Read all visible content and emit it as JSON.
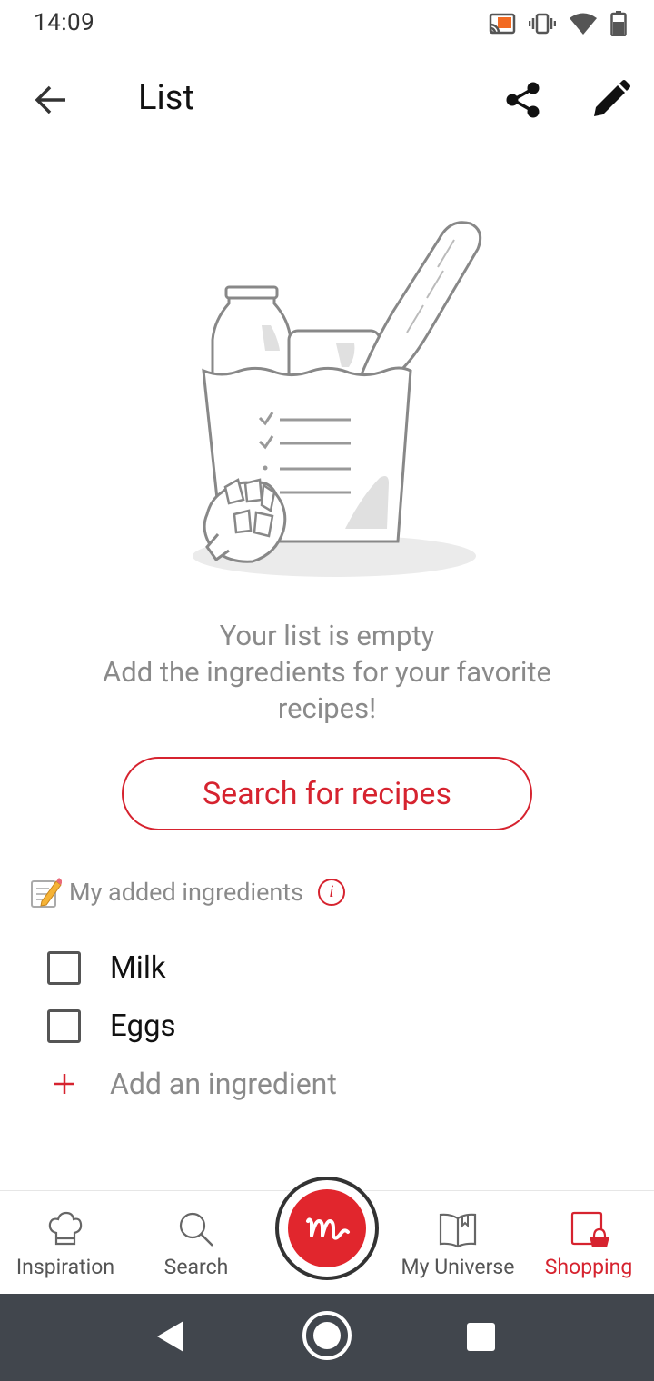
{
  "status_bar": {
    "time": "14:09",
    "icons": [
      "cast-icon",
      "vibrate-icon",
      "wifi-icon",
      "battery-icon"
    ]
  },
  "toolbar": {
    "title": "List",
    "back_icon": "arrow-left-icon",
    "share_icon": "share-icon",
    "edit_icon": "pencil-icon"
  },
  "empty_state": {
    "title": "Your list is empty",
    "description": "Add the ingredients for your favorite recipes!",
    "button_label": "Search for recipes"
  },
  "added_ingredients": {
    "section_label": "My added ingredients",
    "info_glyph": "i",
    "items": [
      {
        "label": "Milk",
        "checked": false
      },
      {
        "label": "Eggs",
        "checked": false
      }
    ],
    "add_label": "Add an ingredient"
  },
  "bottom_nav": {
    "items": [
      {
        "label": "Inspiration",
        "icon": "chef-hat-icon",
        "active": false
      },
      {
        "label": "Search",
        "icon": "search-icon",
        "active": false
      },
      {
        "label": "My Universe",
        "icon": "book-icon",
        "active": false
      },
      {
        "label": "Shopping",
        "icon": "shopping-basket-icon",
        "active": true
      }
    ],
    "center_icon": "logo-m-icon"
  },
  "colors": {
    "accent": "#d6232f",
    "text_muted": "#8a8a8a",
    "system_nav": "#41464d"
  }
}
